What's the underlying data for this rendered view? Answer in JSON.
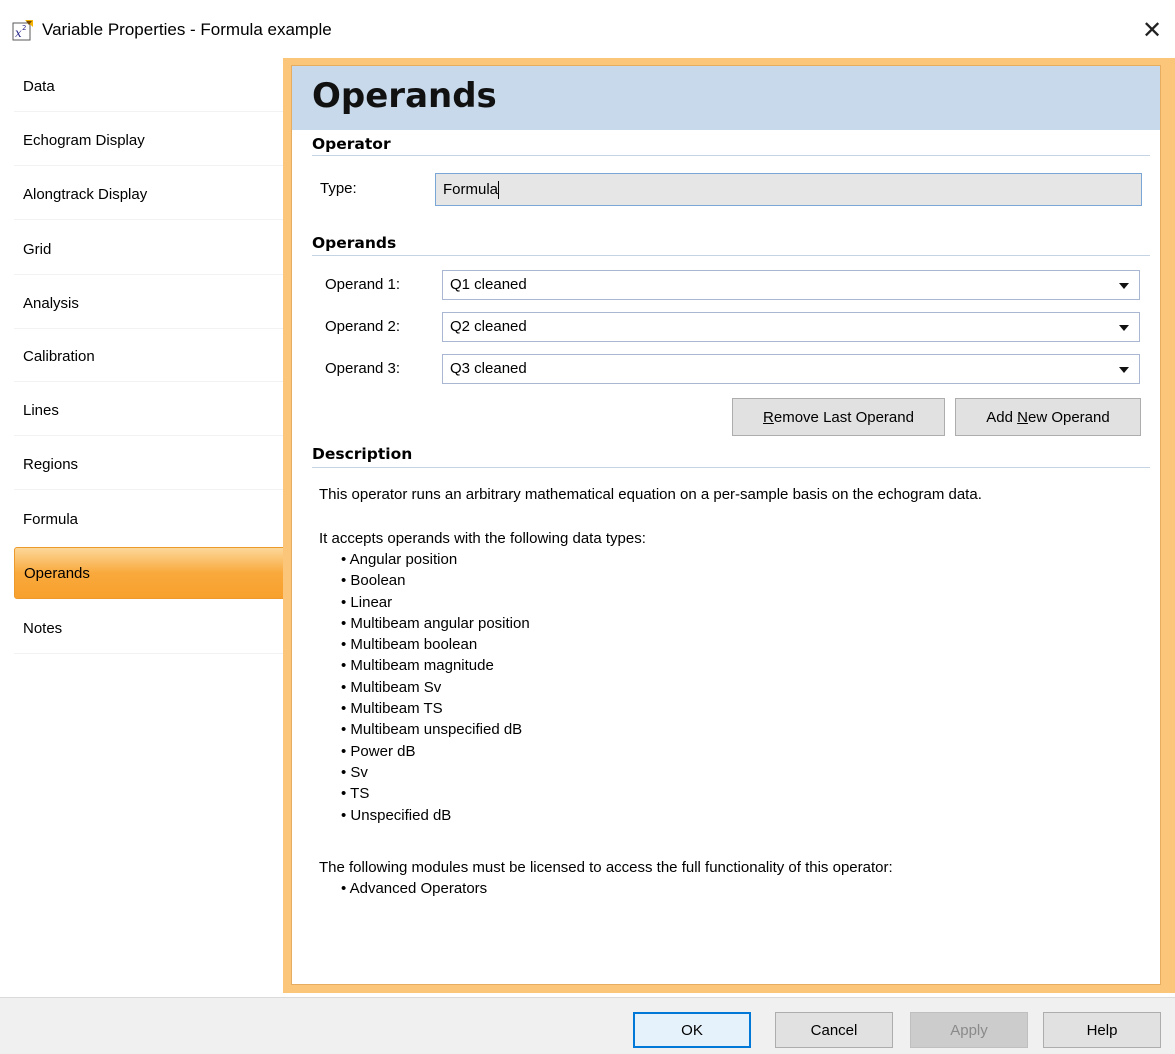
{
  "window": {
    "title": "Variable Properties - Formula example",
    "close_glyph": "✕",
    "icon": "formula-variable-icon"
  },
  "sidebar": {
    "items": [
      {
        "label": "Data"
      },
      {
        "label": "Echogram Display"
      },
      {
        "label": "Alongtrack Display"
      },
      {
        "label": "Grid"
      },
      {
        "label": "Analysis"
      },
      {
        "label": "Calibration"
      },
      {
        "label": "Lines"
      },
      {
        "label": "Regions"
      },
      {
        "label": "Formula"
      },
      {
        "label": "Operands",
        "active": true
      },
      {
        "label": "Notes"
      }
    ]
  },
  "page": {
    "title": "Operands",
    "operator_section": "Operator",
    "type_label": "Type:",
    "type_value": "Formula",
    "operands_section": "Operands",
    "operands": [
      {
        "label": "Operand 1:",
        "value": "Q1 cleaned"
      },
      {
        "label": "Operand 2:",
        "value": "Q2 cleaned"
      },
      {
        "label": "Operand 3:",
        "value": "Q3 cleaned"
      }
    ],
    "remove_button": {
      "pre": "",
      "underline": "R",
      "post": "emove Last Operand"
    },
    "add_button": {
      "pre": "Add ",
      "underline": "N",
      "post": "ew Operand"
    },
    "description_section": "Description",
    "description_line1": "This operator runs an arbitrary mathematical equation on a per-sample basis on the echogram data.",
    "accepts_line": "It accepts operands with the following data types:",
    "data_types": [
      "Angular position",
      "Boolean",
      "Linear",
      "Multibeam angular position",
      "Multibeam boolean",
      "Multibeam magnitude",
      "Multibeam Sv",
      "Multibeam TS",
      "Multibeam unspecified dB",
      "Power dB",
      "Sv",
      "TS",
      "Unspecified dB"
    ],
    "modules_line": "The following modules must be licensed to access the full functionality of this operator:",
    "modules": [
      "Advanced Operators"
    ]
  },
  "footer": {
    "ok": "OK",
    "cancel": "Cancel",
    "apply": "Apply",
    "help": "Help"
  },
  "colors": {
    "header_bg": "#c7d9eb",
    "active_tab": "#f9a93c",
    "panel_frame": "#fbc67a",
    "default_button_border": "#0078d7"
  }
}
